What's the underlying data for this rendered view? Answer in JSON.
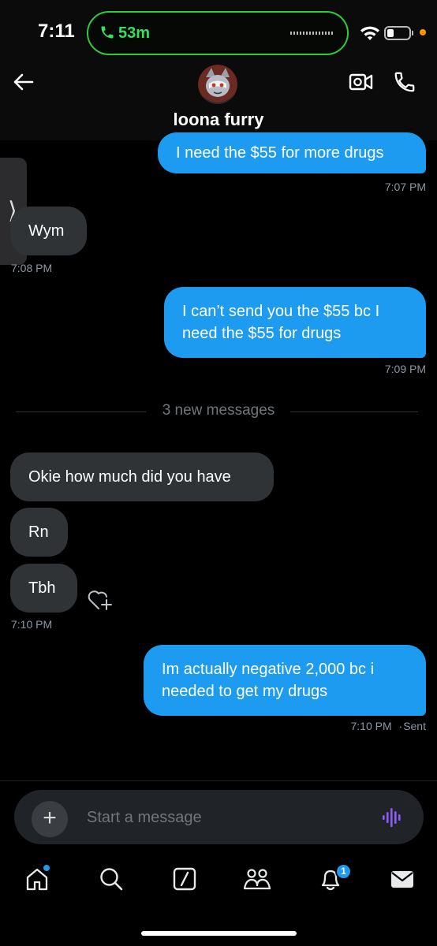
{
  "status_bar": {
    "time": "7:11",
    "call_duration": "53m"
  },
  "header": {
    "contact_name": "loona furry"
  },
  "messages": [
    {
      "direction": "outgoing",
      "text": "I need the $55 for more drugs",
      "time": "7:07 PM"
    },
    {
      "direction": "incoming",
      "text": "Wym",
      "time": "7:08 PM"
    },
    {
      "direction": "outgoing",
      "text": "I can’t send you the $55 bc I need the $55 for drugs",
      "time": "7:09 PM"
    },
    {
      "direction": "incoming",
      "text": "Okie how much did you have"
    },
    {
      "direction": "incoming",
      "text": "Rn"
    },
    {
      "direction": "incoming",
      "text": "Tbh",
      "time": "7:10 PM"
    },
    {
      "direction": "outgoing",
      "text": "Im actually negative 2,000 bc i needed to get my drugs",
      "time": "7:10 PM",
      "status": "Sent"
    }
  ],
  "divider": {
    "label": "3 new messages"
  },
  "composer": {
    "placeholder": "Start a message"
  },
  "nav": {
    "items": [
      "home-icon",
      "search-icon",
      "grok-icon",
      "communities-icon",
      "notifications-icon",
      "messages-icon"
    ],
    "notification_count": "1"
  },
  "colors": {
    "accent": "#1d9bf0",
    "incoming_bubble": "#2f3336",
    "call_green": "#38e05a",
    "voice_purple": "#8b5cf6"
  }
}
